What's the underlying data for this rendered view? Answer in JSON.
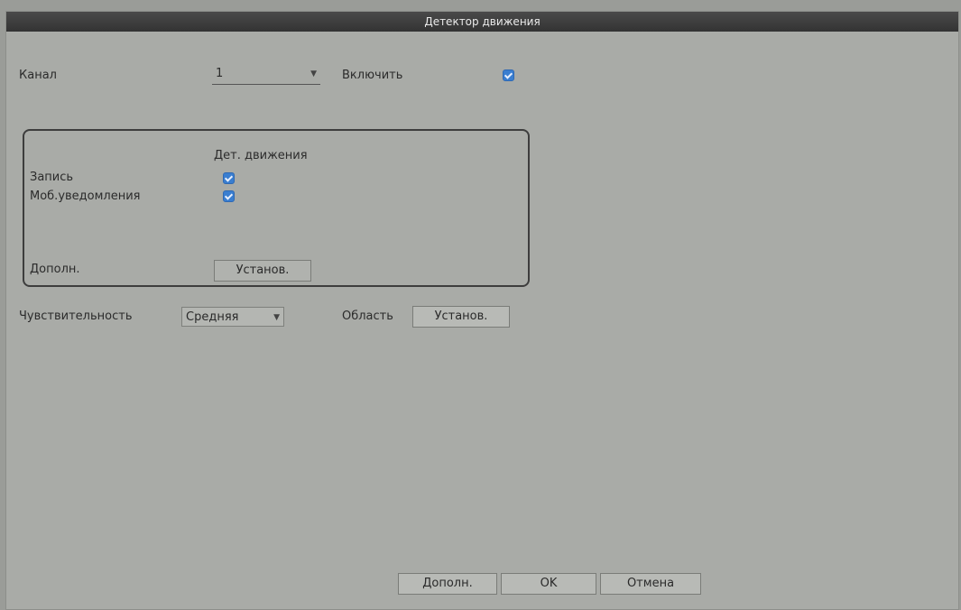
{
  "window": {
    "title": "Детектор движения"
  },
  "channel": {
    "label": "Канал",
    "value": "1"
  },
  "enable": {
    "label": "Включить",
    "checked": true
  },
  "group": {
    "header": "Дет. движения",
    "rows": [
      {
        "label": "Запись",
        "checked": true
      },
      {
        "label": "Моб.уведомления",
        "checked": true
      }
    ],
    "extra_label": "Дополн.",
    "extra_button": "Установ."
  },
  "sensitivity": {
    "label": "Чувствительность",
    "value": "Средняя"
  },
  "area": {
    "label": "Область",
    "button": "Установ."
  },
  "footer": {
    "advanced": "Дополн.",
    "ok": "OK",
    "cancel": "Отмена"
  },
  "colors": {
    "accent": "#3a7ed0",
    "titlebar": "#3a3a3a",
    "background": "#a9aba7"
  }
}
